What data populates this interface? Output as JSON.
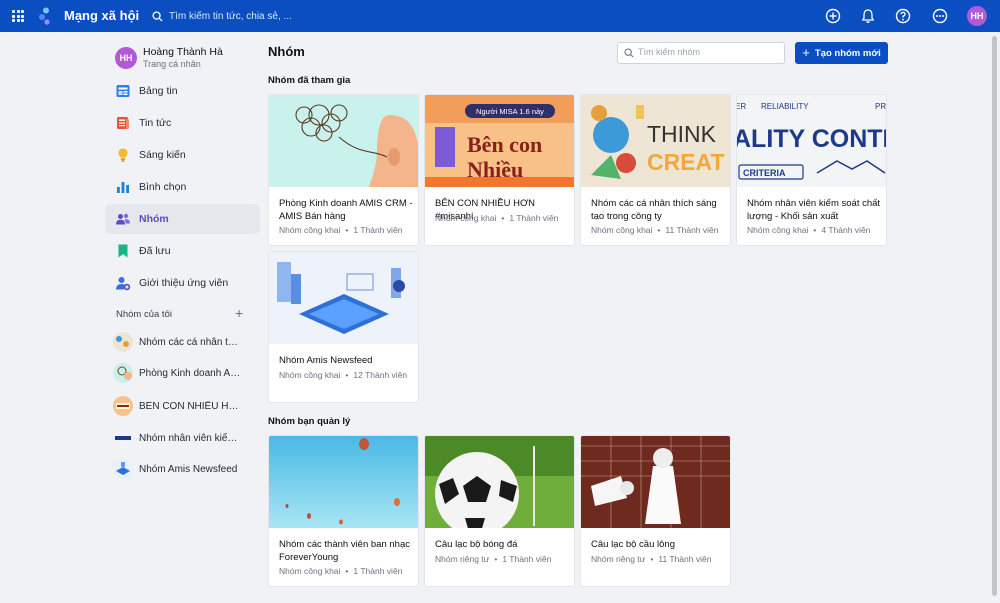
{
  "topbar": {
    "app_title": "Mạng xã hội",
    "search_placeholder": "Tìm kiếm tin tức, chia sẻ, ...",
    "avatar_initials": "HH",
    "icons": [
      "apps-grid-icon",
      "logo-icon",
      "search-icon",
      "plus-circle-icon",
      "bell-icon",
      "help-icon",
      "more-icon"
    ]
  },
  "profile": {
    "initials": "HH",
    "name": "Hoàng Thành Hà",
    "subtitle": "Trang cá nhân"
  },
  "nav": {
    "items": [
      {
        "label": "Bảng tin",
        "icon": "newsfeed-icon"
      },
      {
        "label": "Tin tức",
        "icon": "news-icon"
      },
      {
        "label": "Sáng kiến",
        "icon": "lightbulb-icon"
      },
      {
        "label": "Bình chọn",
        "icon": "poll-icon"
      },
      {
        "label": "Nhóm",
        "icon": "group-icon",
        "active": true
      },
      {
        "label": "Đã lưu",
        "icon": "bookmark-icon"
      },
      {
        "label": "Giới thiệu ứng viên",
        "icon": "candidate-icon"
      }
    ]
  },
  "my_groups": {
    "heading": "Nhóm của tôi",
    "items": [
      {
        "label": "Nhóm các cá nhân thíc..."
      },
      {
        "label": "Phòng Kinh doanh AMI..."
      },
      {
        "label": "BÊN CON NHIỀU HƠN ..."
      },
      {
        "label": "Nhóm nhân viên kiểm ..."
      },
      {
        "label": "Nhóm Amis Newsfeed"
      }
    ]
  },
  "main": {
    "title": "Nhóm",
    "search_placeholder": "Tìm kiếm nhóm",
    "create_label": "Tạo nhóm mới",
    "joined": {
      "title": "Nhóm đã tham gia",
      "groups": [
        {
          "name": "Phòng Kinh doanh AMIS CRM - AMIS Bán hàng",
          "privacy": "Nhóm công khai",
          "members": "1 Thành viên"
        },
        {
          "name": "BÊN CON NHIỀU HƠN #misanhí",
          "privacy": "Nhóm công khai",
          "members": "1 Thành viên"
        },
        {
          "name": "Nhóm các cá nhân thích sáng tạo trong công ty",
          "privacy": "Nhóm công khai",
          "members": "11 Thành viên"
        },
        {
          "name": "Nhóm nhân viên kiểm soát chất lượng - Khối sản xuất",
          "privacy": "Nhóm công khai",
          "members": "4 Thành viên"
        },
        {
          "name": "Nhóm Amis Newsfeed",
          "privacy": "Nhóm công khai",
          "members": "12 Thành viên"
        }
      ]
    },
    "managed": {
      "title": "Nhóm bạn quản lý",
      "groups": [
        {
          "name": "Nhóm các thành viên ban nhạc ForeverYoung",
          "privacy": "Nhóm công khai",
          "members": "1 Thành viên"
        },
        {
          "name": "Câu lạc bộ bóng đá",
          "privacy": "Nhóm riêng tư",
          "members": "1 Thành viên"
        },
        {
          "name": "Câu lạc bộ cầu lông",
          "privacy": "Nhóm riêng tư",
          "members": "11 Thành viên"
        }
      ]
    }
  },
  "image_text": {
    "misa_banner_top": "Người MISA 1.6 này",
    "misa_banner_big1": "Bên con",
    "misa_banner_big2": "Nhiều",
    "think": "THINK",
    "creat": "CREAT",
    "reliability": "RELIABILITY",
    "quality": "ALITY CONTR",
    "criteria": "CRITERIA",
    "er": "ER",
    "pr": "PR"
  },
  "colors": {
    "topbar": "#0a4ec2",
    "accent": "#0a4ec2",
    "avatar": "#b05ad6",
    "active_nav_text": "#5b4bc4"
  }
}
